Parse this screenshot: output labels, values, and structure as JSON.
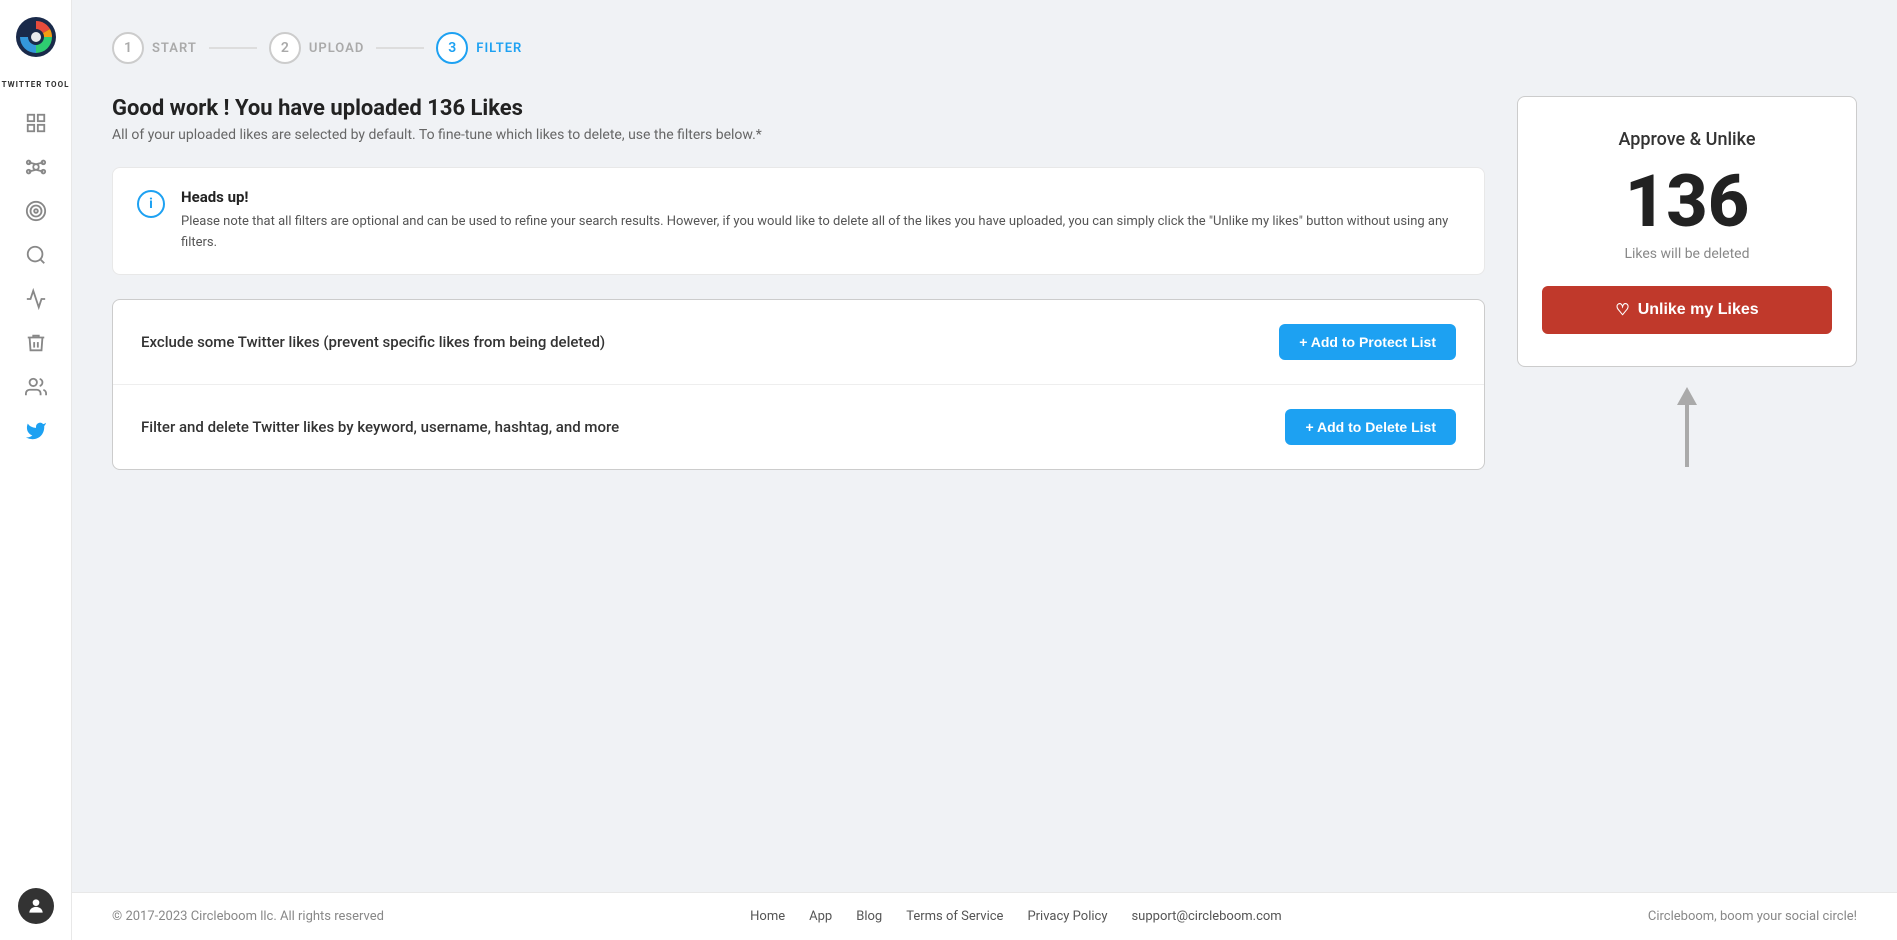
{
  "sidebar": {
    "app_name": "TWITTER TOOL"
  },
  "stepper": {
    "steps": [
      {
        "number": "1",
        "label": "START",
        "active": false
      },
      {
        "number": "2",
        "label": "UPLOAD",
        "active": false
      },
      {
        "number": "3",
        "label": "FILTER",
        "active": true
      }
    ]
  },
  "page": {
    "title": "Good work ! You have uploaded 136 Likes",
    "subtitle": "All of your uploaded likes are selected by default. To fine-tune which likes to delete, use the filters below.*",
    "headsup": {
      "title": "Heads up!",
      "text": "Please note that all filters are optional and can be used to refine your search results. However, if you would like to delete all of the likes you have uploaded, you can simply click the \"Unlike my likes\" button without using any filters."
    },
    "filter_protect": {
      "text": "Exclude some Twitter likes (prevent specific likes from being deleted)",
      "button": "+ Add to Protect List"
    },
    "filter_delete": {
      "text": "Filter and delete Twitter likes by keyword, username, hashtag, and more",
      "button": "+ Add to Delete List"
    }
  },
  "approve": {
    "title": "Approve & Unlike",
    "count": "136",
    "label": "Likes will be deleted",
    "button": "Unlike my Likes"
  },
  "footer": {
    "copy": "© 2017-2023 Circleboom llc. All rights reserved",
    "links": [
      {
        "label": "Home"
      },
      {
        "label": "App"
      },
      {
        "label": "Blog"
      },
      {
        "label": "Terms of Service"
      },
      {
        "label": "Privacy Policy"
      },
      {
        "label": "support@circleboom.com"
      }
    ],
    "tagline": "Circleboom, boom your social circle!"
  }
}
